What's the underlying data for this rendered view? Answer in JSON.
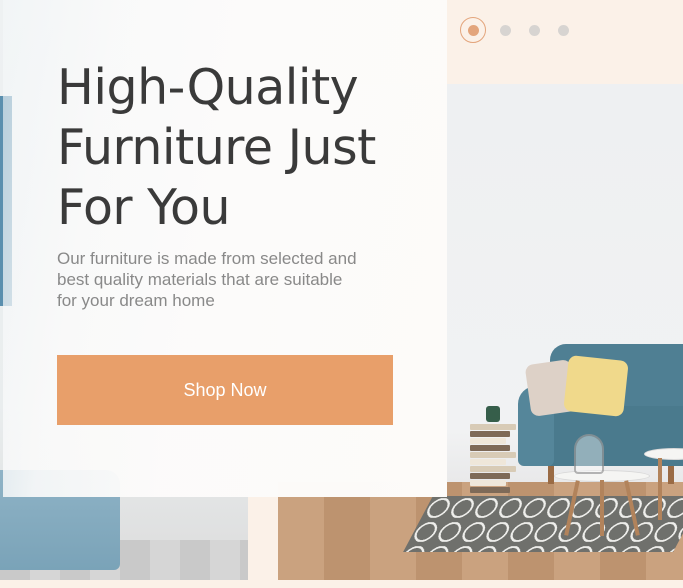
{
  "hero": {
    "title_line1": "High-Quality",
    "title_line2": "Furniture Just",
    "title_line3": "For You",
    "description_line1": "Our furniture is made from selected and",
    "description_line2": "best quality materials that are suitable",
    "description_line3": "for your dream home",
    "button_label": "Shop Now"
  },
  "carousel": {
    "slide_count": 4,
    "active_index": 0
  },
  "colors": {
    "accent": "#e89f6a",
    "page_background": "#fbf1e8",
    "heading": "#3a3a3a",
    "body_text": "#898989"
  }
}
